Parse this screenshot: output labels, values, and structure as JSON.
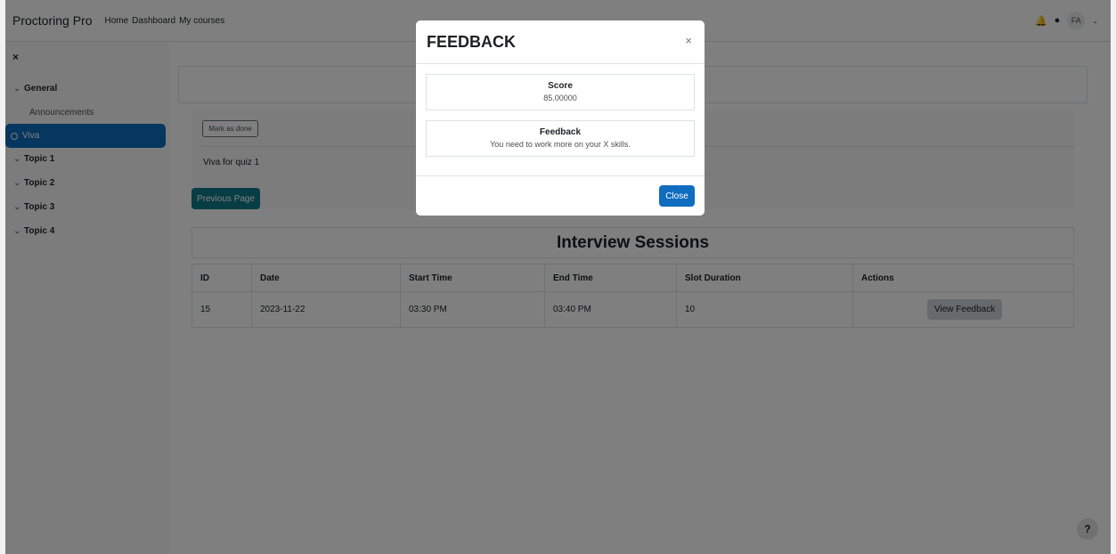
{
  "navbar": {
    "brand": "Proctoring Pro",
    "links": [
      "Home",
      "Dashboard",
      "My courses"
    ],
    "avatar_initials": "FA"
  },
  "drawer": {
    "close": "×",
    "sections": [
      "General",
      "Topic 1",
      "Topic 2",
      "Topic 3",
      "Topic 4"
    ],
    "activities": [
      "Announcements",
      "Viva"
    ]
  },
  "content": {
    "mark_done": "Mark as done",
    "viva_description": "Viva for quiz 1",
    "previous_page": "Previous Page",
    "sessions_title": "Interview Sessions",
    "table": {
      "headers": [
        "ID",
        "Date",
        "Start Time",
        "End Time",
        "Slot Duration",
        "Actions"
      ],
      "rows": [
        {
          "id": "15",
          "date": "2023-11-22",
          "start": "03:30 PM",
          "end": "03:40 PM",
          "duration": "10",
          "action": "View Feedback"
        }
      ]
    },
    "help": "?"
  },
  "modal": {
    "title": "FEEDBACK",
    "close_x": "×",
    "score_label": "Score",
    "score_value": "85.00000",
    "feedback_label": "Feedback",
    "feedback_text": "You need to work more on your X skills.",
    "close_button": "Close"
  },
  "colors": {
    "primary": "#0f6cbf",
    "teal": "#0f7b89",
    "backdrop": "rgba(0,0,0,0.5)"
  }
}
